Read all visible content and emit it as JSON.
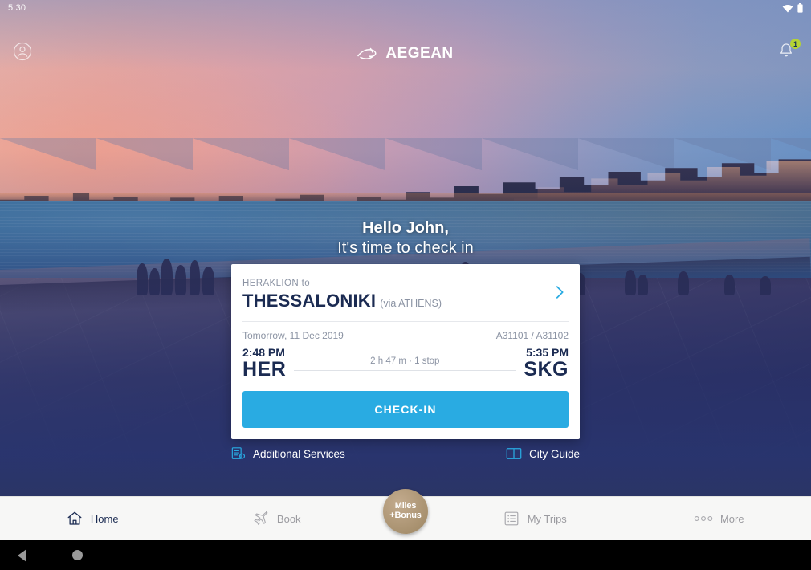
{
  "status_bar": {
    "time": "5:30",
    "wifi_icon": "wifi-icon",
    "battery_icon": "battery-icon"
  },
  "header": {
    "avatar_icon": "account-circle-icon",
    "brand": "AEGEAN",
    "logo_icon": "aegean-bird-logo-icon",
    "notification_icon": "bell-icon",
    "notification_count": "1",
    "badge_color": "#b5d334"
  },
  "greeting": {
    "line1": "Hello John,",
    "line2": "It's time to check in"
  },
  "flight_card": {
    "origin_label": "HERAKLION to",
    "destination": "THESSALONIKI",
    "via": "(via ATHENS)",
    "chevron_icon": "chevron-right-icon",
    "chevron_color": "#29abe2",
    "date": "Tomorrow, 11 Dec 2019",
    "flight_numbers": "A31101 / A31102",
    "depart_time": "2:48 PM",
    "depart_code": "HER",
    "arrive_time": "5:35 PM",
    "arrive_code": "SKG",
    "duration": "2 h 47 m · 1 stop",
    "checkin_label": "CHECK-IN",
    "checkin_color": "#29abe2",
    "text_color": "#1b2b52"
  },
  "quick_links": [
    {
      "label": "Additional Services",
      "icon": "services-document-icon"
    },
    {
      "label": "City Guide",
      "icon": "book-open-icon"
    }
  ],
  "bottom_nav": {
    "items": [
      {
        "label": "Home",
        "icon": "home-icon",
        "active": true
      },
      {
        "label": "Book",
        "icon": "airplane-icon",
        "active": false
      },
      {
        "label": "My Trips",
        "icon": "list-icon",
        "active": false
      },
      {
        "label": "More",
        "icon": "more-dots-icon",
        "active": false
      }
    ],
    "miles_button": {
      "line1": "Miles",
      "line2": "+Bonus",
      "color": "#a8916f"
    }
  },
  "android_nav": {
    "back_icon": "back-triangle-icon",
    "home_icon": "home-circle-icon"
  }
}
